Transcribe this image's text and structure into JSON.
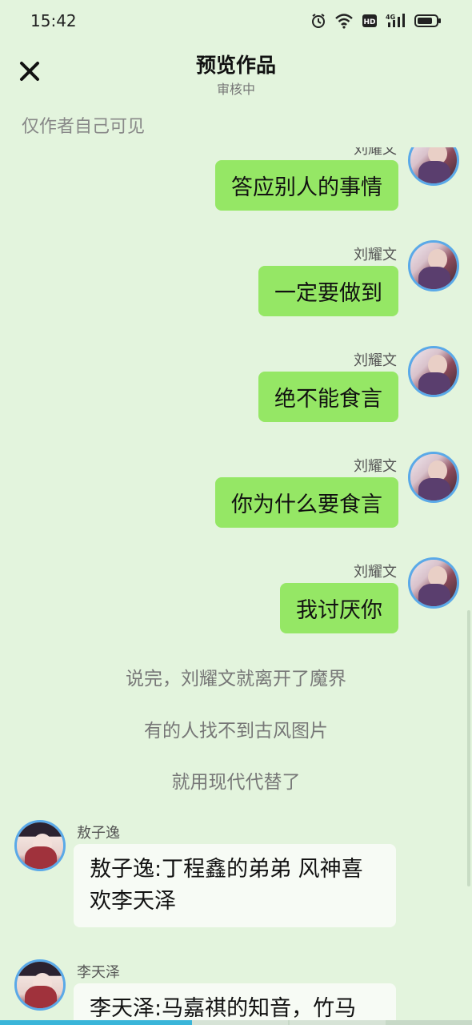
{
  "status_bar": {
    "time": "15:42",
    "icons": [
      "alarm-icon",
      "wifi-icon",
      "hd-icon",
      "signal-4g-icon",
      "battery-icon"
    ]
  },
  "header": {
    "title": "预览作品",
    "subtitle": "审核中",
    "visibility_note": "仅作者自己可见",
    "close_icon": "close-icon"
  },
  "messages_right": [
    {
      "name": "刘耀文",
      "text": "答应别人的事情"
    },
    {
      "name": "刘耀文",
      "text": "一定要做到"
    },
    {
      "name": "刘耀文",
      "text": "绝不能食言"
    },
    {
      "name": "刘耀文",
      "text": "你为什么要食言"
    },
    {
      "name": "刘耀文",
      "text": "我讨厌你"
    }
  ],
  "narrations": [
    "说完，刘耀文就离开了魔界",
    "有的人找不到古风图片",
    "就用现代代替了"
  ],
  "messages_left": [
    {
      "name": "敖子逸",
      "text": "敖子逸:丁程鑫的弟弟 风神喜欢李天泽"
    },
    {
      "name": "李天泽",
      "text": "李天泽:马嘉祺的知音，竹马"
    }
  ],
  "colors": {
    "background": "#e3f4dd",
    "bubble_right": "#95e765",
    "bubble_left": "#f7fbf5",
    "avatar_border": "#5aa9e8",
    "progress": "#3ab5d9"
  }
}
